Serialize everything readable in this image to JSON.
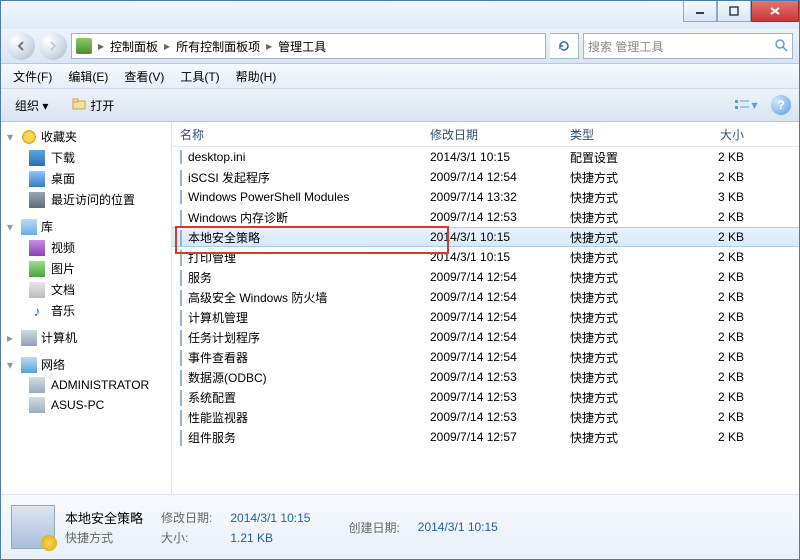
{
  "titlebar": {},
  "address": {
    "crumbs": [
      "控制面板",
      "所有控制面板项",
      "管理工具"
    ],
    "search_placeholder": "搜索 管理工具"
  },
  "menubar": [
    "文件(F)",
    "编辑(E)",
    "查看(V)",
    "工具(T)",
    "帮助(H)"
  ],
  "cmdbar": {
    "organize": "组织 ▾",
    "open": "打开"
  },
  "nav": {
    "fav": {
      "label": "收藏夹",
      "items": [
        "下载",
        "桌面",
        "最近访问的位置"
      ]
    },
    "lib": {
      "label": "库",
      "items": [
        "视频",
        "图片",
        "文档",
        "音乐"
      ]
    },
    "comp": {
      "label": "计算机"
    },
    "net": {
      "label": "网络",
      "items": [
        "ADMINISTRATOR",
        "ASUS-PC"
      ]
    }
  },
  "columns": {
    "name": "名称",
    "date": "修改日期",
    "type": "类型",
    "size": "大小"
  },
  "files": [
    {
      "name": "desktop.ini",
      "date": "2014/3/1 10:15",
      "type": "配置设置",
      "size": "2 KB",
      "icon": "ini"
    },
    {
      "name": "iSCSI 发起程序",
      "date": "2009/7/14 12:54",
      "type": "快捷方式",
      "size": "2 KB",
      "icon": "lnk"
    },
    {
      "name": "Windows PowerShell Modules",
      "date": "2009/7/14 13:32",
      "type": "快捷方式",
      "size": "3 KB",
      "icon": "lnk"
    },
    {
      "name": "Windows 内存诊断",
      "date": "2009/7/14 12:53",
      "type": "快捷方式",
      "size": "2 KB",
      "icon": "lnk"
    },
    {
      "name": "本地安全策略",
      "date": "2014/3/1 10:15",
      "type": "快捷方式",
      "size": "2 KB",
      "icon": "lnk",
      "selected": true,
      "highlighted": true
    },
    {
      "name": "打印管理",
      "date": "2014/3/1 10:15",
      "type": "快捷方式",
      "size": "2 KB",
      "icon": "lnk"
    },
    {
      "name": "服务",
      "date": "2009/7/14 12:54",
      "type": "快捷方式",
      "size": "2 KB",
      "icon": "lnk"
    },
    {
      "name": "高级安全 Windows 防火墙",
      "date": "2009/7/14 12:54",
      "type": "快捷方式",
      "size": "2 KB",
      "icon": "lnk"
    },
    {
      "name": "计算机管理",
      "date": "2009/7/14 12:54",
      "type": "快捷方式",
      "size": "2 KB",
      "icon": "lnk"
    },
    {
      "name": "任务计划程序",
      "date": "2009/7/14 12:54",
      "type": "快捷方式",
      "size": "2 KB",
      "icon": "lnk"
    },
    {
      "name": "事件查看器",
      "date": "2009/7/14 12:54",
      "type": "快捷方式",
      "size": "2 KB",
      "icon": "lnk"
    },
    {
      "name": "数据源(ODBC)",
      "date": "2009/7/14 12:53",
      "type": "快捷方式",
      "size": "2 KB",
      "icon": "lnk"
    },
    {
      "name": "系统配置",
      "date": "2009/7/14 12:53",
      "type": "快捷方式",
      "size": "2 KB",
      "icon": "lnk"
    },
    {
      "name": "性能监视器",
      "date": "2009/7/14 12:53",
      "type": "快捷方式",
      "size": "2 KB",
      "icon": "lnk"
    },
    {
      "name": "组件服务",
      "date": "2009/7/14 12:57",
      "type": "快捷方式",
      "size": "2 KB",
      "icon": "lnk"
    }
  ],
  "details": {
    "title": "本地安全策略",
    "subtitle": "快捷方式",
    "mod_label": "修改日期:",
    "mod_val": "2014/3/1 10:15",
    "create_label": "创建日期:",
    "create_val": "2014/3/1 10:15",
    "size_label": "大小:",
    "size_val": "1.21 KB"
  }
}
